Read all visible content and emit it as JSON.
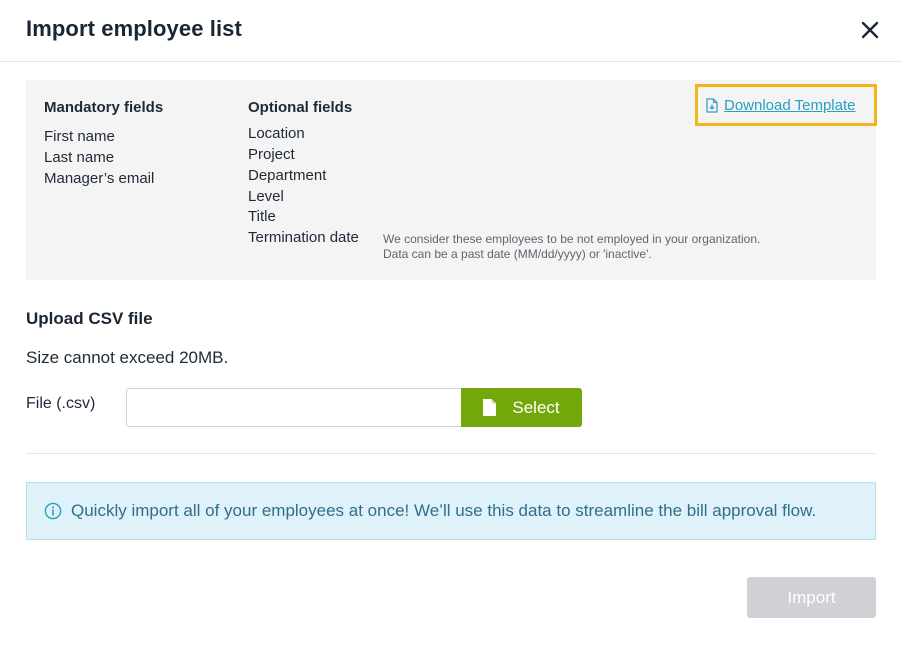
{
  "dialog": {
    "title": "Import employee list"
  },
  "fields": {
    "mandatory_heading": "Mandatory fields",
    "mandatory": [
      "First name",
      "Last name",
      "Manager’s email"
    ],
    "optional_heading": "Optional fields",
    "optional": [
      "Location",
      "Project",
      "Department",
      "Level",
      "Title",
      "Termination date"
    ],
    "termination_note_line1": "We consider these employees to be not employed in your organization.",
    "termination_note_line2": "Data can be a past date (MM/dd/yyyy) or 'inactive'.",
    "download_label": "Download Template"
  },
  "upload": {
    "heading": "Upload CSV file",
    "size_note": "Size cannot exceed 20MB.",
    "file_label": "File (.csv)",
    "file_value": "",
    "select_label": "Select"
  },
  "info": {
    "text": "Quickly import all of your employees at once! We’ll use this data to streamline the bill approval flow."
  },
  "actions": {
    "import_label": "Import"
  },
  "colors": {
    "select_button": "#73a80b",
    "download_highlight": "#f2b418",
    "link": "#2a9fc0",
    "info_background": "#dff1f9",
    "import_disabled": "#cfd1d4"
  }
}
